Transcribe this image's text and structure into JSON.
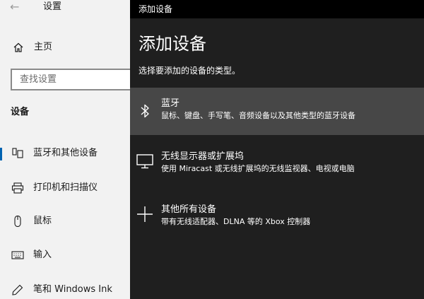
{
  "settings_window": {
    "title": "设置",
    "back_icon": "arrow-left-icon",
    "home_label": "主页",
    "search_placeholder": "查找设置",
    "section_title": "设备",
    "nav_items": [
      {
        "label": "蓝牙和其他设备",
        "icon": "bluetooth-devices-icon",
        "selected": true
      },
      {
        "label": "打印机和扫描仪",
        "icon": "printer-icon",
        "selected": false
      },
      {
        "label": "鼠标",
        "icon": "mouse-icon",
        "selected": false
      },
      {
        "label": "输入",
        "icon": "keyboard-icon",
        "selected": false
      },
      {
        "label": "笔和 Windows Ink",
        "icon": "pen-icon",
        "selected": false
      }
    ],
    "accent_color": "#0063b1"
  },
  "dialog": {
    "window_title": "添加设备",
    "heading": "添加设备",
    "subtitle": "选择要添加的设备的类型。",
    "options": [
      {
        "name": "蓝牙",
        "description": "鼠标、键盘、手写笔、音频设备以及其他类型的蓝牙设备",
        "icon": "bluetooth-icon",
        "highlighted": true
      },
      {
        "name": "无线显示器或扩展坞",
        "description": "使用 Miracast 或无线扩展坞的无线监视器、电视或电脑",
        "icon": "monitor-icon",
        "highlighted": false
      },
      {
        "name": "其他所有设备",
        "description": "带有无线适配器、DLNA 等的 Xbox 控制器",
        "icon": "plus-icon",
        "highlighted": false
      }
    ],
    "background_color": "#1f1f1f",
    "highlight_color": "#474747"
  }
}
